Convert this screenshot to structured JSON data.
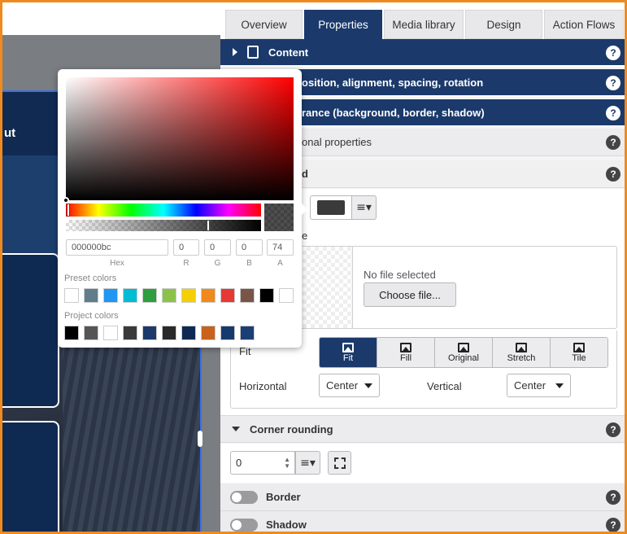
{
  "tabs": [
    "Overview",
    "Properties",
    "Media library",
    "Design",
    "Action Flows"
  ],
  "active_tab": "Properties",
  "canvas": {
    "header_fragment": "ut"
  },
  "sections": {
    "content": "Content",
    "position": "osition, alignment, spacing, rotation",
    "appearance": "rance (background, border, shadow)",
    "additional": "onal properties",
    "background": "d"
  },
  "help_label": "?",
  "image_label_fragment": "e",
  "file": {
    "status": "No file selected",
    "choose_button": "Choose file..."
  },
  "fit": {
    "label": "Fit",
    "options": [
      "Fit",
      "Fill",
      "Original",
      "Stretch",
      "Tile"
    ],
    "selected": "Fit"
  },
  "alignment": {
    "horizontal_label": "Horizontal",
    "horizontal_value": "Center",
    "vertical_label": "Vertical",
    "vertical_value": "Center"
  },
  "corner_rounding": {
    "label": "Corner rounding",
    "value": "0"
  },
  "border": {
    "label": "Border"
  },
  "shadow": {
    "label": "Shadow"
  },
  "picker": {
    "hex": "000000bc",
    "r": "0",
    "g": "0",
    "b": "0",
    "a": "74",
    "labels": {
      "hex": "Hex",
      "r": "R",
      "g": "G",
      "b": "B",
      "a": "A"
    },
    "preset_title": "Preset colors",
    "project_title": "Project colors",
    "preset_colors": [
      "#ffffff",
      "#607d8b",
      "#2196f3",
      "#00bcd4",
      "#2e9e3e",
      "#8bc34a",
      "#f5d000",
      "#f08a1c",
      "#e53935",
      "#795548",
      "#000000",
      "#ffffff"
    ],
    "project_colors": [
      "#000000",
      "#555555",
      "#ffffff",
      "#3a3a3a",
      "#1b3a6b",
      "#2a2a2a",
      "#0e2a52",
      "#c8621c",
      "#163a6e",
      "#1b3f75"
    ]
  },
  "colors": {
    "accent": "#1b3a6b",
    "frame": "#f08a1c"
  }
}
